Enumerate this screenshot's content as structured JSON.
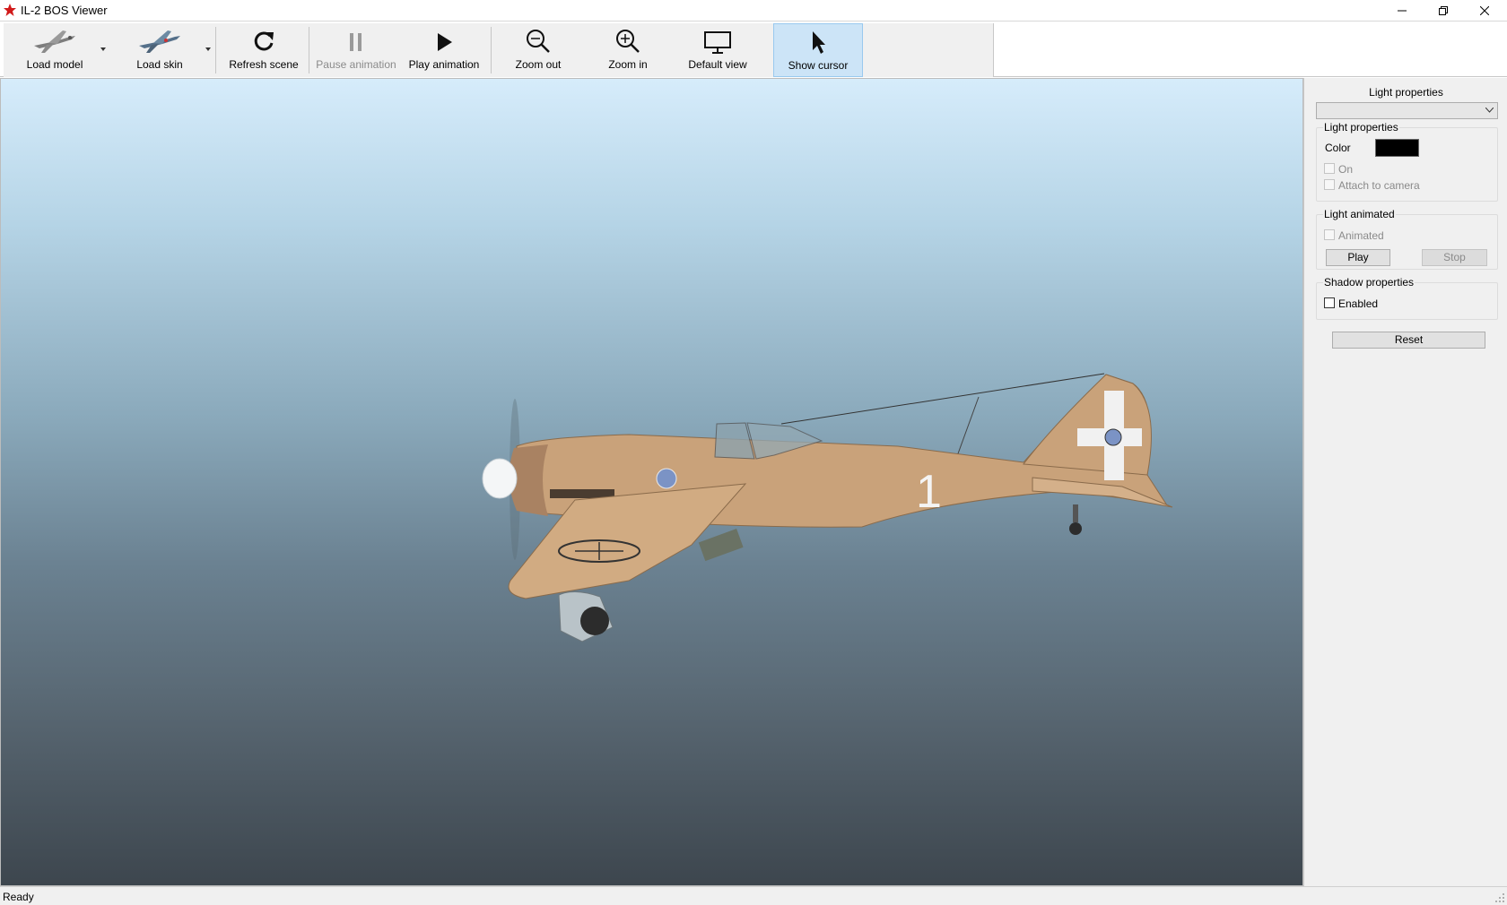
{
  "window": {
    "title": "IL-2 BOS Viewer",
    "app_icon": "red-star-icon",
    "controls": [
      "minimize-icon",
      "restore-icon",
      "close-icon"
    ]
  },
  "toolbar": {
    "load_model": "Load model",
    "load_skin": "Load skin",
    "refresh_scene": "Refresh scene",
    "pause_animation": "Pause animation",
    "play_animation": "Play animation",
    "zoom_out": "Zoom out",
    "zoom_in": "Zoom in",
    "default_view": "Default view",
    "show_cursor": "Show cursor"
  },
  "viewport": {
    "scene": "aircraft-3d-model",
    "fuselage_number": "1",
    "colors": {
      "sky_top": "#d6ecfb",
      "sky_bottom": "#3d464e",
      "airframe": "#c9a27a"
    }
  },
  "panel": {
    "title": "Light properties",
    "selector_value": "",
    "light_group": {
      "title": "Light properties",
      "color_label": "Color",
      "color_value": "#000000",
      "on_label": "On",
      "attach_label": "Attach to camera"
    },
    "animated_group": {
      "title": "Light animated",
      "animated_label": "Animated",
      "play_label": "Play",
      "stop_label": "Stop"
    },
    "shadow_group": {
      "title": "Shadow properties",
      "enabled_label": "Enabled"
    },
    "reset_label": "Reset"
  },
  "status": {
    "text": "Ready"
  }
}
